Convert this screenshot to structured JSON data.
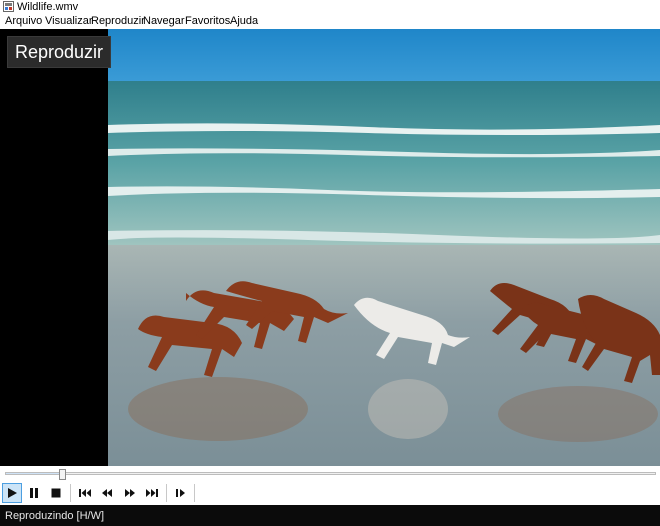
{
  "window": {
    "title": "Wildlife.wmv"
  },
  "menu": {
    "items": [
      "Arquivo",
      "Visualizar",
      "Reproduzir",
      "Navegar",
      "Favoritos",
      "Ajuda"
    ]
  },
  "video": {
    "osd_label": "Reproduzir"
  },
  "seek": {
    "position_fraction": 0.088
  },
  "controls": {
    "buttons": [
      "play-icon",
      "pause-icon",
      "stop-icon",
      "skip-back-icon",
      "rewind-icon",
      "fast-forward-icon",
      "skip-forward-icon",
      "frame-step-icon"
    ],
    "active": "play"
  },
  "status": {
    "text": "Reproduzindo [H/W]"
  },
  "colors": {
    "accent": "#4c9fe1",
    "pressed_bg": "#cce4f7",
    "status_bg": "#0b0b0b"
  }
}
